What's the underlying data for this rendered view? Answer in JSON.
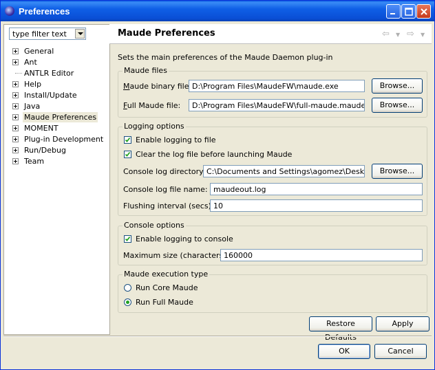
{
  "window": {
    "title": "Preferences"
  },
  "filter": {
    "placeholder": "type filter text"
  },
  "tree": [
    {
      "label": "General",
      "expandable": true
    },
    {
      "label": "Ant",
      "expandable": true
    },
    {
      "label": "ANTLR Editor",
      "expandable": false
    },
    {
      "label": "Help",
      "expandable": true
    },
    {
      "label": "Install/Update",
      "expandable": true
    },
    {
      "label": "Java",
      "expandable": true
    },
    {
      "label": "Maude Preferences",
      "expandable": true,
      "selected": true
    },
    {
      "label": "MOMENT",
      "expandable": true
    },
    {
      "label": "Plug-in Development",
      "expandable": true
    },
    {
      "label": "Run/Debug",
      "expandable": true
    },
    {
      "label": "Team",
      "expandable": true
    }
  ],
  "page": {
    "title": "Maude Preferences",
    "description": "Sets the main preferences of the Maude Daemon plug-in"
  },
  "maude_files": {
    "legend": "Maude files",
    "binary_label_u": "M",
    "binary_label_rest": "aude binary file:",
    "binary_value": "D:\\Program Files\\MaudeFW\\maude.exe",
    "full_label_u": "F",
    "full_label_rest": "ull Maude file:",
    "full_value": "D:\\Program Files\\MaudeFW\\full-maude.maude",
    "browse": "Browse..."
  },
  "logging": {
    "legend": "Logging options",
    "enable_file": "Enable logging to file",
    "clear_log": "Clear the log file before launching Maude",
    "dir_label": "Console log directory:",
    "dir_value": "C:\\Documents and Settings\\agomez\\Desktop",
    "browse": "Browse...",
    "name_label": "Console log file name:",
    "name_value": "maudeout.log",
    "flush_label": "Flushing interval (secs):",
    "flush_value": "10"
  },
  "console": {
    "legend": "Console options",
    "enable_console": "Enable logging to console",
    "max_label": "Maximum size (characters):",
    "max_value": "160000"
  },
  "execution": {
    "legend": "Maude execution type",
    "core": "Run Core Maude",
    "full": "Run Full Maude",
    "selected": "full"
  },
  "buttons": {
    "restore": "Restore Defaults",
    "apply": "Apply",
    "ok": "OK",
    "cancel": "Cancel"
  }
}
